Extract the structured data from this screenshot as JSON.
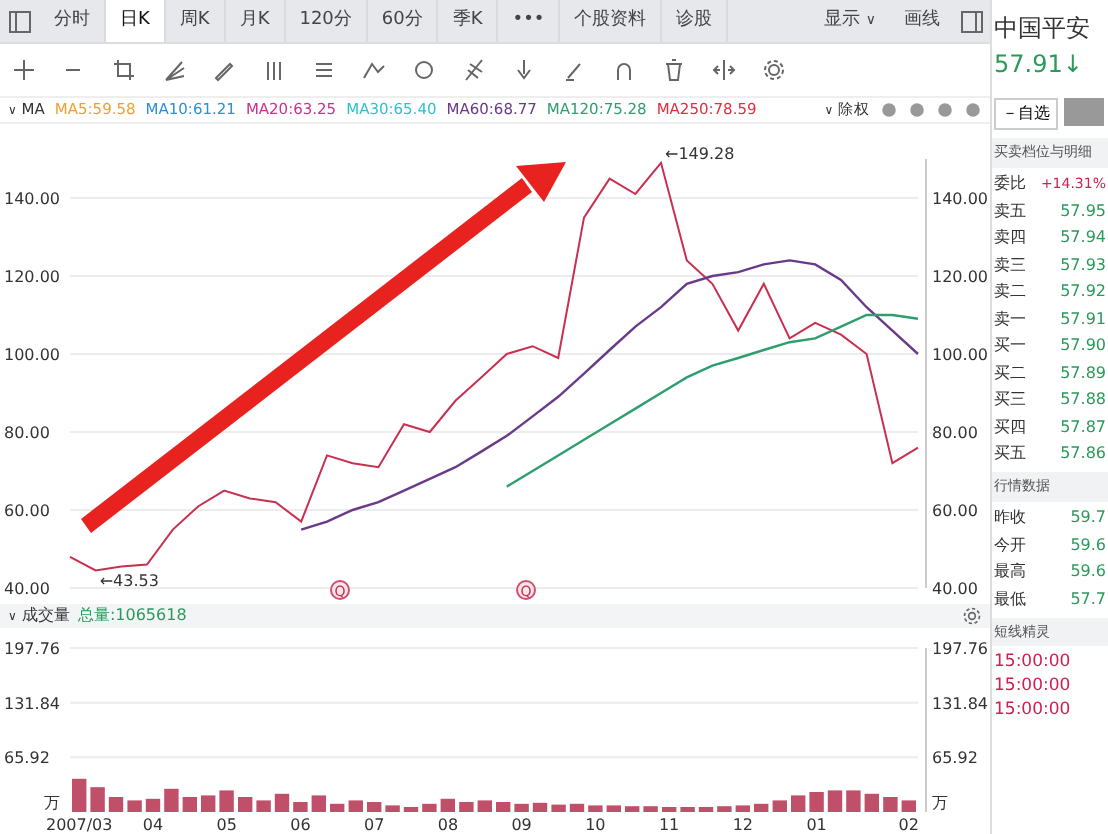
{
  "tabs": [
    {
      "label": "分时",
      "selected": false
    },
    {
      "label": "日K",
      "selected": true
    },
    {
      "label": "周K",
      "selected": false
    },
    {
      "label": "月K",
      "selected": false
    },
    {
      "label": "120分",
      "selected": false
    },
    {
      "label": "60分",
      "selected": false
    },
    {
      "label": "季K",
      "selected": false
    },
    {
      "label": "•••",
      "selected": false
    },
    {
      "label": "个股资料",
      "selected": false
    },
    {
      "label": "诊股",
      "selected": false
    }
  ],
  "top_right": {
    "display": "显示",
    "display_caret": "∨",
    "draw": "画线"
  },
  "ma_legend": {
    "caret": "∨",
    "label": "MA",
    "items": [
      {
        "text": "MA5:59.58",
        "color": "#f0a030"
      },
      {
        "text": "MA10:61.21",
        "color": "#2f8fd8"
      },
      {
        "text": "MA20:63.25",
        "color": "#d0308f"
      },
      {
        "text": "MA30:65.40",
        "color": "#30c0d0"
      },
      {
        "text": "MA60:68.77",
        "color": "#6a3a8a"
      },
      {
        "text": "MA120:75.28",
        "color": "#2e9e6e"
      },
      {
        "text": "MA250:78.59",
        "color": "#e03040"
      }
    ],
    "adjust_caret": "∨",
    "adjust": "除权"
  },
  "price_chart": {
    "chart_data": {
      "type": "line",
      "categories": [
        null,
        null,
        null,
        null,
        null,
        null,
        null,
        null,
        null,
        null,
        null,
        null,
        null,
        null,
        null,
        null,
        null,
        null,
        null,
        null,
        null,
        null,
        null,
        null,
        null,
        null,
        null,
        null,
        null,
        null,
        null,
        null,
        null,
        null
      ],
      "grid": true,
      "ylim": [
        40,
        150
      ],
      "yticks": [
        {
          "value": 140,
          "label": "140.00"
        },
        {
          "value": 120,
          "label": "120.00"
        },
        {
          "value": 100,
          "label": "100.00"
        },
        {
          "value": 80,
          "label": "80.00"
        },
        {
          "value": 60,
          "label": "60.00"
        },
        {
          "value": 40,
          "label": "40.00"
        }
      ],
      "series": [
        {
          "color": "#c83050",
          "values": [
            48,
            44.5,
            45.5,
            46,
            55,
            61,
            65,
            63,
            62,
            57,
            74,
            72,
            71,
            82,
            80,
            88,
            94,
            100,
            102,
            99,
            135,
            145,
            141,
            149,
            124,
            118,
            106,
            118,
            104,
            108,
            105,
            100,
            72,
            76
          ]
        },
        {
          "color": "#6a3a8a",
          "values": [
            null,
            null,
            null,
            null,
            null,
            null,
            null,
            null,
            null,
            55,
            57,
            60,
            62,
            65,
            68,
            71,
            75,
            79,
            84,
            89,
            95,
            101,
            107,
            112,
            118,
            120,
            121,
            123,
            124,
            123,
            119,
            112,
            106,
            100
          ]
        },
        {
          "color": "#2e9e6e",
          "values": [
            null,
            null,
            null,
            null,
            null,
            null,
            null,
            null,
            null,
            null,
            null,
            null,
            null,
            null,
            null,
            null,
            null,
            66,
            70,
            74,
            78,
            82,
            86,
            90,
            94,
            97,
            99,
            101,
            103,
            104,
            107,
            110,
            110,
            109
          ]
        }
      ],
      "annotations": [
        {
          "text": "←149.28"
        },
        {
          "text": "←43.53"
        }
      ]
    },
    "markers": [
      "Q",
      "Q"
    ]
  },
  "volume": {
    "caret": "∨",
    "label": "成交量",
    "total": "总量:1065618",
    "units": [
      "万",
      "万"
    ],
    "chart_data": {
      "type": "bar",
      "grid": true,
      "ylim": [
        0,
        197.76
      ],
      "yticks": [
        {
          "value": 65.92,
          "label": "65.92"
        },
        {
          "value": 131.84,
          "label": "131.84"
        },
        {
          "value": 197.76,
          "label": "197.76"
        }
      ],
      "categories": [
        "2007/03",
        null,
        null,
        null,
        "04",
        null,
        null,
        null,
        "05",
        null,
        null,
        null,
        "06",
        null,
        null,
        null,
        "07",
        null,
        null,
        null,
        "08",
        null,
        null,
        null,
        "09",
        null,
        null,
        null,
        "10",
        null,
        null,
        null,
        "11",
        null,
        null,
        null,
        "12",
        null,
        null,
        null,
        "01",
        null,
        null,
        null,
        null,
        "02"
      ],
      "series": [
        {
          "color": "#c0506a",
          "values": [
            40,
            30,
            18,
            14,
            16,
            28,
            18,
            20,
            26,
            18,
            14,
            22,
            12,
            20,
            10,
            14,
            12,
            8,
            6,
            10,
            16,
            12,
            14,
            12,
            10,
            11,
            9,
            10,
            8,
            8,
            7,
            7,
            6,
            6,
            6,
            7,
            8,
            10,
            14,
            20,
            24,
            26,
            26,
            22,
            18,
            14
          ]
        }
      ]
    }
  },
  "stock": {
    "name": "中国平安",
    "price": "57.91",
    "arrow": "↓"
  },
  "watch_button": "－自选",
  "order_book": {
    "title": "买卖档位与明细",
    "ratio_label": "委比",
    "ratio": "+14.31%",
    "rows": [
      {
        "label": "卖五",
        "price": "57.95"
      },
      {
        "label": "卖四",
        "price": "57.94"
      },
      {
        "label": "卖三",
        "price": "57.93"
      },
      {
        "label": "卖二",
        "price": "57.92"
      },
      {
        "label": "卖一",
        "price": "57.91"
      },
      {
        "label": "买一",
        "price": "57.90"
      },
      {
        "label": "买二",
        "price": "57.89"
      },
      {
        "label": "买三",
        "price": "57.88"
      },
      {
        "label": "买四",
        "price": "57.87"
      },
      {
        "label": "买五",
        "price": "57.86"
      }
    ]
  },
  "quote": {
    "title": "行情数据",
    "rows": [
      {
        "label": "昨收",
        "value": "59.7"
      },
      {
        "label": "今开",
        "value": "59.6"
      },
      {
        "label": "最高",
        "value": "59.6"
      },
      {
        "label": "最低",
        "value": "57.7"
      }
    ]
  },
  "short_line": {
    "title": "短线精灵",
    "times": [
      "15:00:00",
      "15:00:00",
      "15:00:00"
    ]
  }
}
